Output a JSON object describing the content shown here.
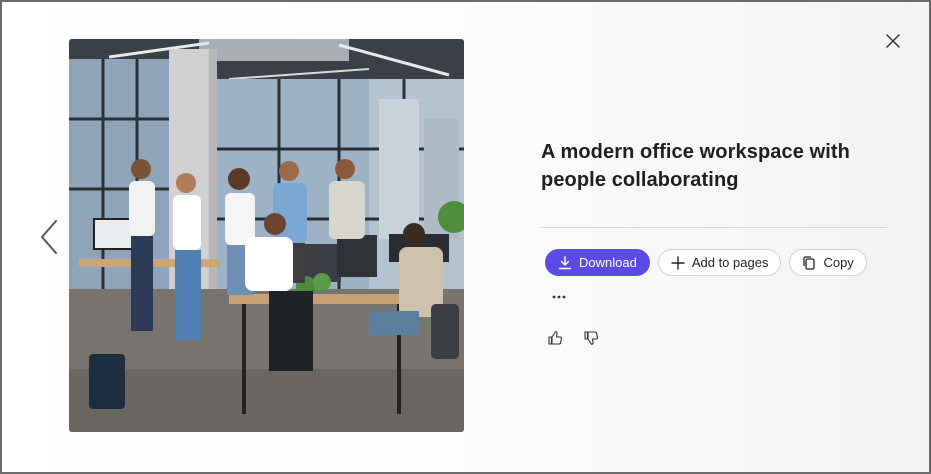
{
  "viewer": {
    "title": "A modern office workspace with people collaborating",
    "close_icon": "close-icon",
    "prev_icon": "chevron-left-icon",
    "image_description_icon": "office-photo"
  },
  "actions": {
    "download_label": "Download",
    "add_to_pages_label": "Add to pages",
    "copy_label": "Copy",
    "more_label": "..."
  },
  "feedback": {
    "like_icon": "thumbs-up-icon",
    "dislike_icon": "thumbs-down-icon"
  },
  "colors": {
    "primary": "#5b4be6",
    "text": "#1f1f1f",
    "border": "#d1d1d1"
  }
}
